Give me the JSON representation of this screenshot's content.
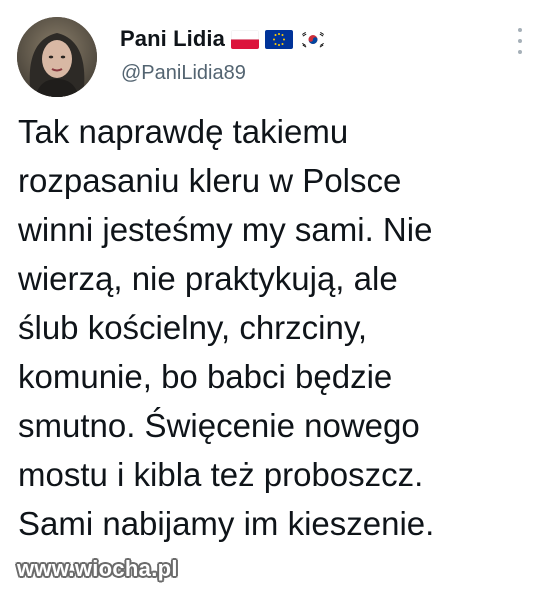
{
  "author": {
    "display_name": "Pani Lidia",
    "handle": "@PaniLidia89",
    "flags": [
      "poland-flag",
      "eu-flag",
      "south-korea-flag"
    ]
  },
  "tweet": {
    "lines": [
      "Tak naprawdę takiemu",
      "rozpasaniu kleru w Polsce",
      "winni jesteśmy my sami. Nie",
      "wierzą, nie praktykują, ale",
      "ślub kościelny, chrzciny,",
      "komunie, bo babci będzie",
      "smutno. Święcenie nowego",
      "mostu i kibla też proboszcz.",
      "Sami nabijamy im kieszenie."
    ]
  },
  "watermark": "www.wiocha.pl",
  "icons": {
    "more": "more-options-icon"
  },
  "colors": {
    "text": "#0f1419",
    "secondary": "#536471",
    "background": "#ffffff"
  }
}
